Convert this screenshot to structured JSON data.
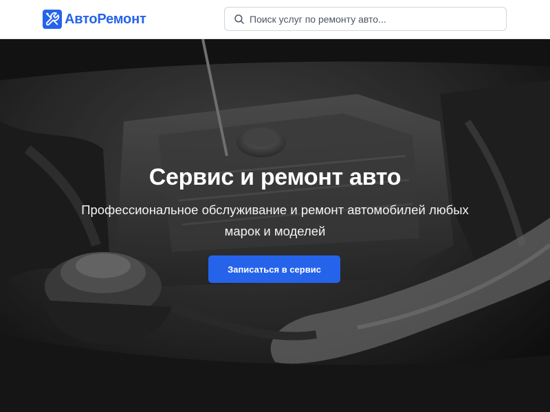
{
  "header": {
    "logo": {
      "text": "АвтоРемонт",
      "icon": "wrench-screwdriver-icon",
      "badge_color": "#2563eb"
    },
    "search": {
      "placeholder": "Поиск услуг по ремонту авто...",
      "value": "",
      "icon": "search-icon"
    }
  },
  "hero": {
    "title": "Сервис и ремонт авто",
    "subtitle": "Профессиональное обслуживание и ремонт автомобилей любых марок и моделей",
    "cta_label": "Записаться в сервис",
    "cta_color": "#2563eb",
    "background": "car-engine-bay-photo"
  }
}
